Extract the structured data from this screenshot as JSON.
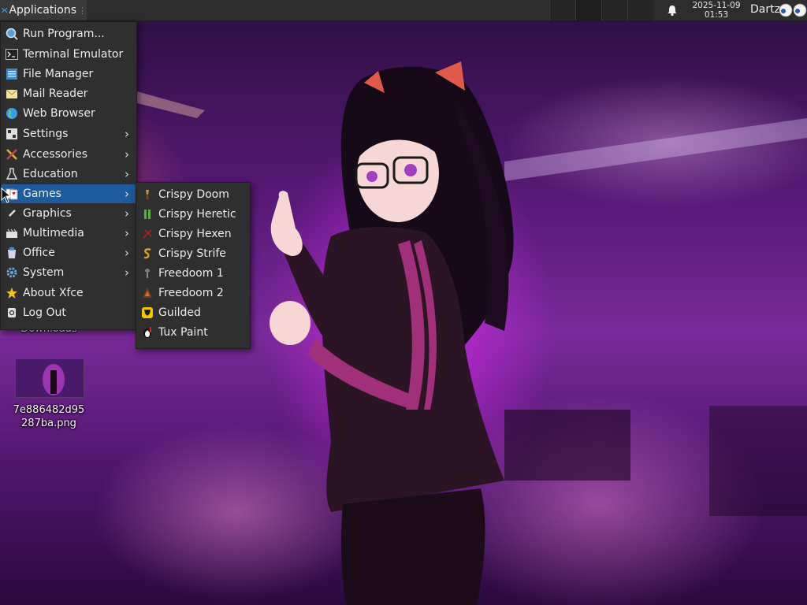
{
  "panel": {
    "apps_label": "Applications",
    "clock_date": "2025-11-09",
    "clock_time": "01:53",
    "user": "Dartz"
  },
  "desktop": {
    "downloads_label": "Downloads",
    "file_label_line1": "7e886482d95",
    "file_label_line2": "287ba.png"
  },
  "menu": {
    "items": [
      {
        "label": "Run Program...",
        "icon": "run-program-icon"
      },
      {
        "label": "Terminal Emulator",
        "icon": "terminal-icon"
      },
      {
        "label": "File Manager",
        "icon": "file-manager-icon"
      },
      {
        "label": "Mail Reader",
        "icon": "mail-icon"
      },
      {
        "label": "Web Browser",
        "icon": "web-browser-icon"
      },
      {
        "label": "Settings",
        "icon": "settings-icon",
        "submenu": true
      },
      {
        "label": "Accessories",
        "icon": "accessories-icon",
        "submenu": true
      },
      {
        "label": "Education",
        "icon": "education-icon",
        "submenu": true
      },
      {
        "label": "Games",
        "icon": "games-icon",
        "submenu": true,
        "active": true
      },
      {
        "label": "Graphics",
        "icon": "graphics-icon",
        "submenu": true
      },
      {
        "label": "Multimedia",
        "icon": "multimedia-icon",
        "submenu": true
      },
      {
        "label": "Office",
        "icon": "office-icon",
        "submenu": true
      },
      {
        "label": "System",
        "icon": "system-icon",
        "submenu": true
      },
      {
        "label": "About Xfce",
        "icon": "about-star-icon"
      },
      {
        "label": "Log Out",
        "icon": "log-out-icon"
      }
    ],
    "arrow": "›"
  },
  "games": {
    "items": [
      {
        "label": "Crispy Doom",
        "icon": "crispy-doom-icon"
      },
      {
        "label": "Crispy Heretic",
        "icon": "crispy-heretic-icon"
      },
      {
        "label": "Crispy Hexen",
        "icon": "crispy-hexen-icon"
      },
      {
        "label": "Crispy Strife",
        "icon": "crispy-strife-icon"
      },
      {
        "label": "Freedoom 1",
        "icon": "freedoom-1-icon"
      },
      {
        "label": "Freedoom 2",
        "icon": "freedoom-2-icon"
      },
      {
        "label": "Guilded",
        "icon": "guilded-icon"
      },
      {
        "label": "Tux Paint",
        "icon": "tux-paint-icon"
      }
    ]
  },
  "colors": {
    "panel_bg": "#2d2d2d",
    "menu_bg": "#2f2f2f",
    "highlight": "#1e5a9c"
  }
}
